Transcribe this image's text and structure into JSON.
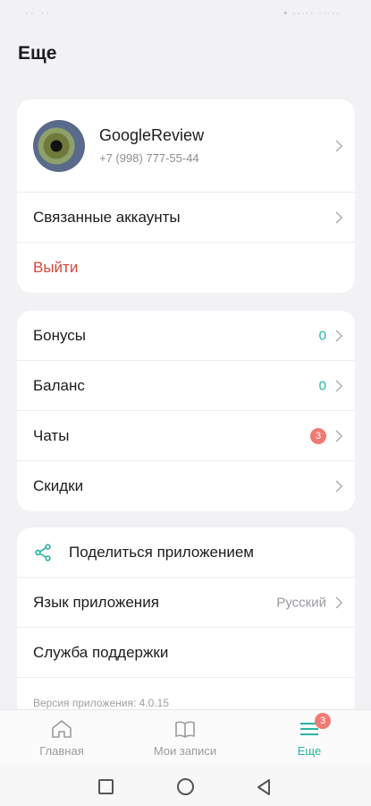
{
  "status_bar": {
    "left": "·· ··",
    "right": "▪ ····· ·····"
  },
  "page": {
    "title": "Еще"
  },
  "profile": {
    "name": "GoogleReview",
    "phone": "+7 (998) 777-55-44"
  },
  "account": {
    "linked_accounts": "Связанные аккаунты",
    "logout": "Выйти"
  },
  "wallet": {
    "items": [
      {
        "label": "Бонусы",
        "value": "0"
      },
      {
        "label": "Баланс",
        "value": "0"
      },
      {
        "label": "Чаты",
        "badge": "3"
      },
      {
        "label": "Скидки"
      }
    ]
  },
  "settings": {
    "share": "Поделиться приложением",
    "language_label": "Язык приложения",
    "language_value": "Русский",
    "support": "Служба поддержки",
    "version": "Версия приложения: 4.0.15"
  },
  "bottom_nav": {
    "home": "Главная",
    "records": "Мои записи",
    "more": "Еще",
    "more_badge": "3"
  },
  "colors": {
    "accent": "#27b5a3",
    "danger": "#d9453a",
    "badge": "#f07b73"
  }
}
